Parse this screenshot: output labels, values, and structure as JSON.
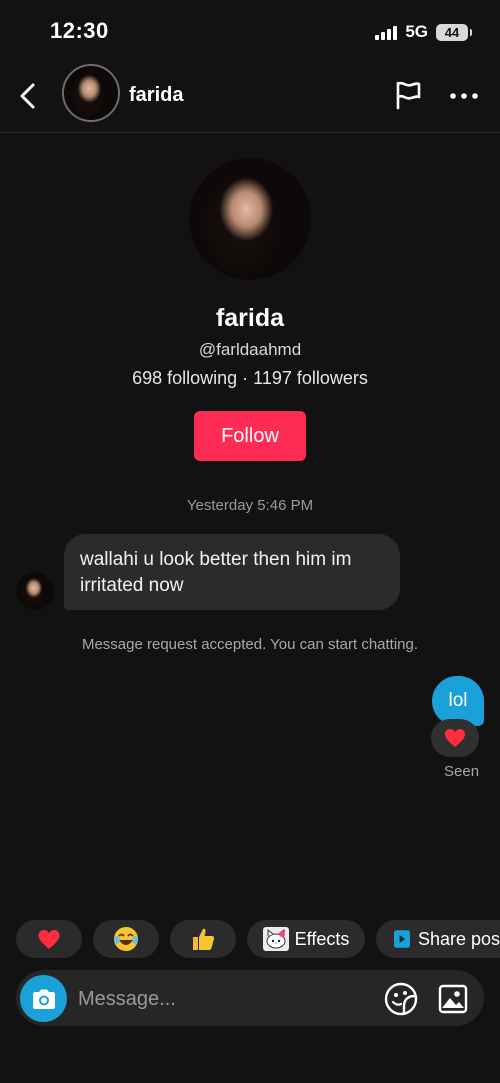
{
  "status_bar": {
    "time": "12:30",
    "network": "5G",
    "battery": "44"
  },
  "header": {
    "back_icon": "chevron-left-icon",
    "name": "farida",
    "flag_icon": "flag-icon",
    "more_icon": "more-horizontal-icon"
  },
  "profile": {
    "name": "farida",
    "handle": "@farldaahmd",
    "stats": "698 following · 1197 followers",
    "follow_label": "Follow"
  },
  "conversation": {
    "timestamp": "Yesterday 5:46 PM",
    "incoming_message": "wallahi u look better then him im irritated now",
    "system_message": "Message request accepted. You can start chatting.",
    "outgoing_message": "lol",
    "reaction": "❤️",
    "seen_label": "Seen"
  },
  "quick_replies": [
    {
      "label": "❤️"
    },
    {
      "label": "😂"
    },
    {
      "label": "👍"
    },
    {
      "label": "Effects",
      "icon": "hello-kitty-icon"
    },
    {
      "label": "Share pos",
      "icon": "play-icon"
    }
  ],
  "composer": {
    "placeholder": "Message...",
    "camera_icon": "camera-icon",
    "sticker_icon": "sticker-icon",
    "image_icon": "image-icon"
  },
  "colors": {
    "background": "#121212",
    "follow_button": "#fe2c55",
    "outgoing_bubble": "#1aa1d8",
    "incoming_bubble": "#2b2b2b"
  }
}
